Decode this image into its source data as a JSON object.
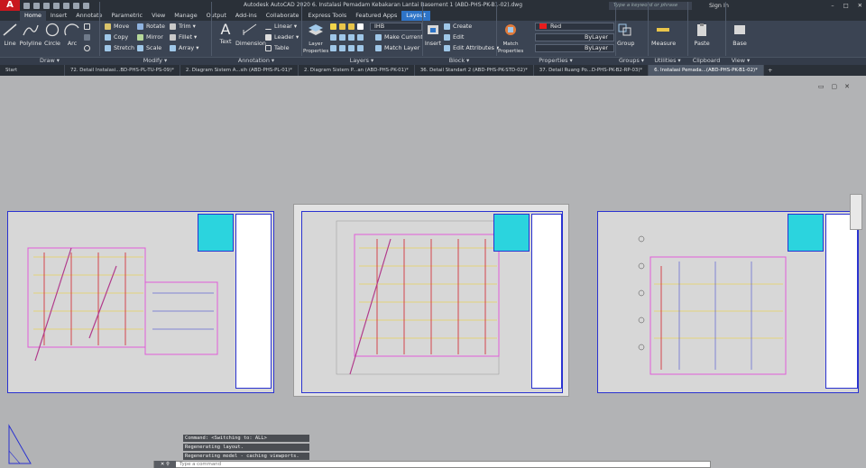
{
  "app": {
    "logo": "A",
    "title": "Autodesk AutoCAD 2020    6. Instalasi Pemadam Kebakaran Lantai Basement 1 (ABD-PHS-PK-B1-02).dwg",
    "search_placeholder": "Type a keyword or phrase",
    "sign_in": "Sign In",
    "win_controls": [
      "–",
      "□",
      "✕"
    ]
  },
  "ribbon_tabs": [
    "Home",
    "Insert",
    "Annotate",
    "Parametric",
    "View",
    "Manage",
    "Output",
    "Add-ins",
    "Collaborate",
    "Express Tools",
    "Featured Apps",
    "Layout"
  ],
  "draw": {
    "line": "Line",
    "polyline": "Polyline",
    "circle": "Circle",
    "arc": "Arc",
    "group": "Draw ▾"
  },
  "modify": {
    "move": "Move",
    "rotate": "Rotate",
    "trim": "Trim ▾",
    "copy": "Copy",
    "mirror": "Mirror",
    "fillet": "Fillet ▾",
    "stretch": "Stretch",
    "scale": "Scale",
    "array": "Array ▾",
    "group": "Modify ▾"
  },
  "annotation": {
    "text": "Text",
    "dimension": "Dimension",
    "linear": "Linear ▾",
    "leader": "Leader ▾",
    "table": "Table",
    "group": "Annotation ▾"
  },
  "layers": {
    "props": "Layer Properties",
    "layer_name": "IHB",
    "make_current": "Make Current",
    "match_layer": "Match Layer",
    "group": "Layers ▾"
  },
  "block": {
    "insert": "Insert",
    "create": "Create",
    "edit": "Edit",
    "edit_attributes": "Edit Attributes ▾",
    "group": "Block ▾"
  },
  "properties": {
    "match": "Match Properties",
    "color": "Red",
    "linetype": "ByLayer",
    "lineweight": "ByLayer",
    "group": "Properties ▾"
  },
  "groups": {
    "group": "Group",
    "label": "Groups ▾"
  },
  "utilities": {
    "measure": "Measure",
    "label": "Utilities ▾"
  },
  "clipboard": {
    "paste": "Paste",
    "label": "Clipboard"
  },
  "view": {
    "base": "Base",
    "label": "View ▾"
  },
  "doc_tabs": [
    "Start",
    "72. Detail Instalasi...BD-PHS-PL-TU-PS-09)*",
    "2. Diagram Sistem A...sih (ABD-PHS-PL-01)*",
    "2. Diagram Sistem P...an (ABD-PHS-PK-01)*",
    "36. Detail Standart 2 (ABD-PHS-PK-STD-02)*",
    "37. Detail Ruang Po...D-PHS-PK-B2-RP-03)*",
    "6. Instalasi Pemada...(ABD-PHS-PK-B1-02)*"
  ],
  "command_history": [
    "Command:  <Switching to: ALL>",
    "Regenerating layout.",
    "Regenerating model - caching viewports."
  ],
  "command_placeholder": "Type a command",
  "colors": {
    "accent": "#2e74c7",
    "ribbon": "#3b4453",
    "canvas": "#b2b3b5"
  }
}
